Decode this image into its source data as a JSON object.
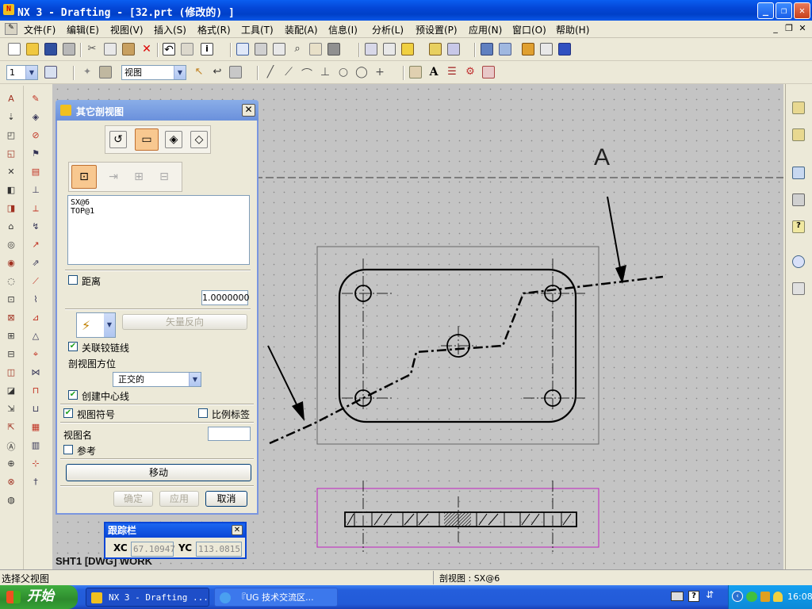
{
  "window": {
    "title": "NX 3 - Drafting - [32.prt  (修改的) ]",
    "btn_min": "_",
    "btn_restore": "❐",
    "btn_close": "✕"
  },
  "menu": {
    "items": [
      "文件(F)",
      "编辑(E)",
      "视图(V)",
      "插入(S)",
      "格式(R)",
      "工具(T)",
      "装配(A)",
      "信息(I)",
      "分析(L)",
      "预设置(P)",
      "应用(N)",
      "窗口(O)",
      "帮助(H)"
    ],
    "win_min": "_",
    "win_restore": "❐",
    "win_close": "✕"
  },
  "toolbar": {
    "layer_combo": "1",
    "view_combo": "视图"
  },
  "dialog": {
    "title": "其它剖视图",
    "close": "✕",
    "list_items": [
      "SX@6",
      "TOP@1"
    ],
    "distance_label": "距离",
    "distance_value": "1.0000000",
    "reverse_vector": "矢量反向",
    "assoc_hinge": "关联铰链线",
    "section_orient_label": "剖视图方位",
    "orient_value": "正交的",
    "create_centerline": "创建中心线",
    "view_label": "视图符号",
    "scale_label": "比例标签",
    "view_name_label": "视图名",
    "reference_label": "参考",
    "move_button": "移动",
    "ok_button": "确定",
    "apply_button": "应用",
    "cancel_button": "取消",
    "checkbox_states": {
      "distance": false,
      "assoc_hinge": true,
      "create_centerline": true,
      "view_label": true,
      "scale_label": false,
      "reference": false
    }
  },
  "tracking": {
    "title": "跟踪栏",
    "close": "✕",
    "xc_label": "XC",
    "xc_value": "67.10947",
    "yc_label": "YC",
    "yc_value": "113.0815"
  },
  "canvas": {
    "section_letter": "A",
    "sheet_label": "SHT1 [DWG] WORK"
  },
  "status": {
    "prompt": "选择父视图",
    "info": "剖视图 : SX@6"
  },
  "taskbar": {
    "start": "开始",
    "tasks": [
      "NX 3 - Drafting ...",
      "『UG 技术交流区..."
    ],
    "clock": "16:08"
  }
}
